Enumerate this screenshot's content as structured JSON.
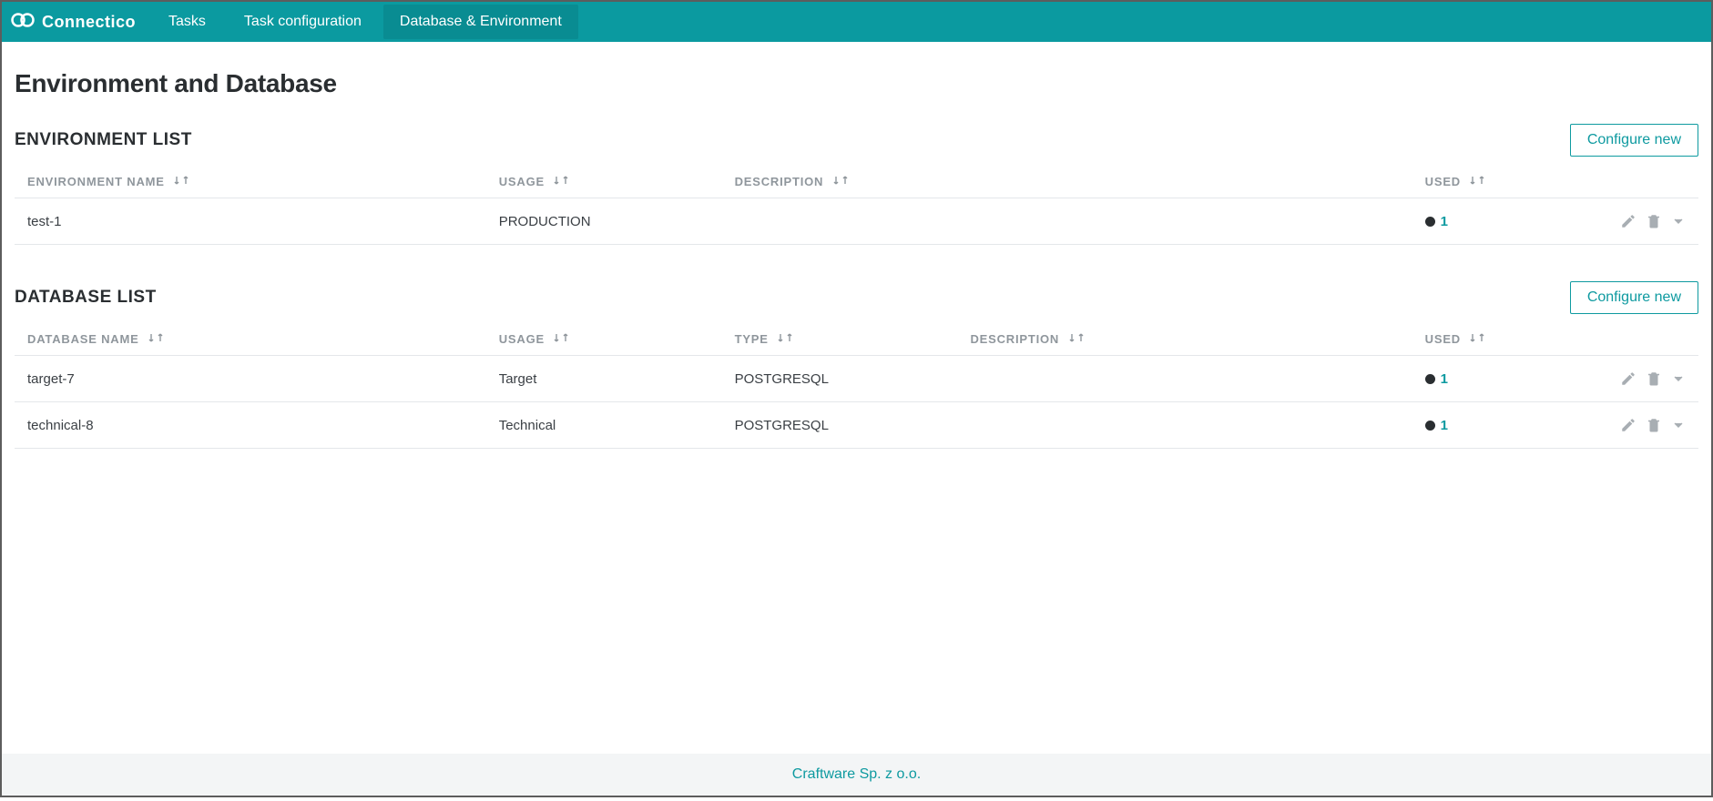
{
  "brand": "Connectico",
  "nav": {
    "items": [
      {
        "label": "Tasks",
        "active": false
      },
      {
        "label": "Task configuration",
        "active": false
      },
      {
        "label": "Database & Environment",
        "active": true
      }
    ]
  },
  "page_title": "Environment and Database",
  "env_section": {
    "title": "ENVIRONMENT LIST",
    "button": "Configure new",
    "columns": {
      "name": "ENVIRONMENT NAME",
      "usage": "USAGE",
      "description": "DESCRIPTION",
      "used": "USED"
    },
    "rows": [
      {
        "name": "test-1",
        "usage": "PRODUCTION",
        "description": "",
        "used": "1"
      }
    ]
  },
  "db_section": {
    "title": "DATABASE LIST",
    "button": "Configure new",
    "columns": {
      "name": "DATABASE NAME",
      "usage": "USAGE",
      "type": "TYPE",
      "description": "DESCRIPTION",
      "used": "USED"
    },
    "rows": [
      {
        "name": "target-7",
        "usage": "Target",
        "type": "POSTGRESQL",
        "description": "",
        "used": "1"
      },
      {
        "name": "technical-8",
        "usage": "Technical",
        "type": "POSTGRESQL",
        "description": "",
        "used": "1"
      }
    ]
  },
  "footer": "Craftware Sp. z o.o."
}
